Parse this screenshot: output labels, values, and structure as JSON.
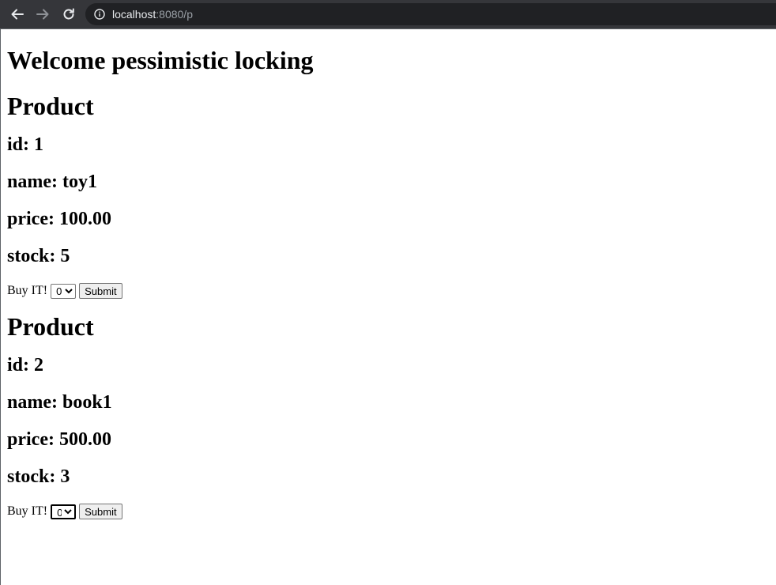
{
  "browser": {
    "url_host": "localhost",
    "url_rest": ":8080/p"
  },
  "page": {
    "title": "Welcome pessimistic locking",
    "products": [
      {
        "heading": "Product",
        "id_text": "id: 1",
        "name_text": "name: toy1",
        "price_text": "price: 100.00",
        "stock_text": "stock: 5",
        "buy_label": "Buy IT!",
        "qty_selected": "0",
        "submit_label": "Submit"
      },
      {
        "heading": "Product",
        "id_text": "id: 2",
        "name_text": "name: book1",
        "price_text": "price: 500.00",
        "stock_text": "stock: 3",
        "buy_label": "Buy IT!",
        "qty_selected": "0",
        "submit_label": "Submit"
      }
    ]
  }
}
